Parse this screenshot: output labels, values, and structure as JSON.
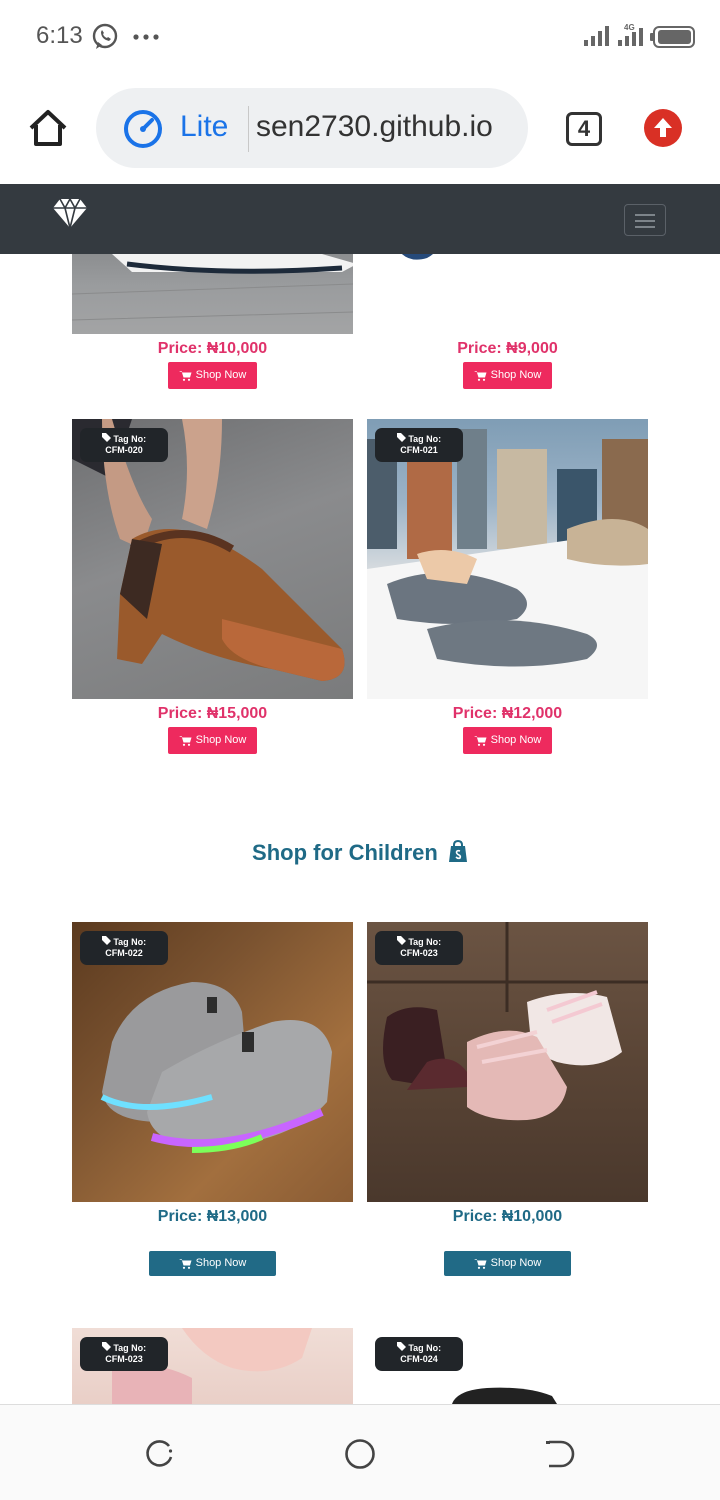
{
  "status_bar": {
    "time": "6:13",
    "network": "4G",
    "icons": [
      "whatsapp-icon",
      "more-dots-icon",
      "signal-icon",
      "network-4g-icon",
      "battery-icon"
    ]
  },
  "browser": {
    "mode_label": "Lite",
    "url": "sen2730.github.io",
    "tab_count": "4",
    "icons": [
      "home-icon",
      "lite-speed-icon",
      "update-arrow-icon"
    ]
  },
  "site_nav": {
    "brand_icon": "diamond-icon",
    "toggler_icon": "hamburger-icon"
  },
  "colors": {
    "navbar": "#343a40",
    "pink": "#ee2a5e",
    "teal": "#216a86",
    "tag_bg": "#212529"
  },
  "products_top": [
    {
      "price": "Price: ₦10,000",
      "button": "Shop Now"
    },
    {
      "price": "Price: ₦9,000",
      "button": "Shop Now"
    }
  ],
  "products_women": [
    {
      "tag_label": "Tag No:",
      "tag_code": "CFM-020",
      "price": "Price: ₦15,000",
      "button": "Shop Now"
    },
    {
      "tag_label": "Tag No:",
      "tag_code": "CFM-021",
      "price": "Price: ₦12,000",
      "button": "Shop Now"
    }
  ],
  "children_section": {
    "title": "Shop for Children",
    "title_icon": "shopping-bag-icon"
  },
  "products_children": [
    {
      "tag_label": "Tag No:",
      "tag_code": "CFM-022",
      "price": "Price: ₦13,000",
      "button": "Shop Now"
    },
    {
      "tag_label": "Tag No:",
      "tag_code": "CFM-023",
      "price": "Price: ₦10,000",
      "button": "Shop Now"
    }
  ],
  "products_bottom": [
    {
      "tag_label": "Tag No:",
      "tag_code": "CFM-023"
    },
    {
      "tag_label": "Tag No:",
      "tag_code": "CFM-024"
    }
  ],
  "system_nav": {
    "icons": [
      "recents-icon",
      "home-circle-icon",
      "back-icon"
    ]
  }
}
